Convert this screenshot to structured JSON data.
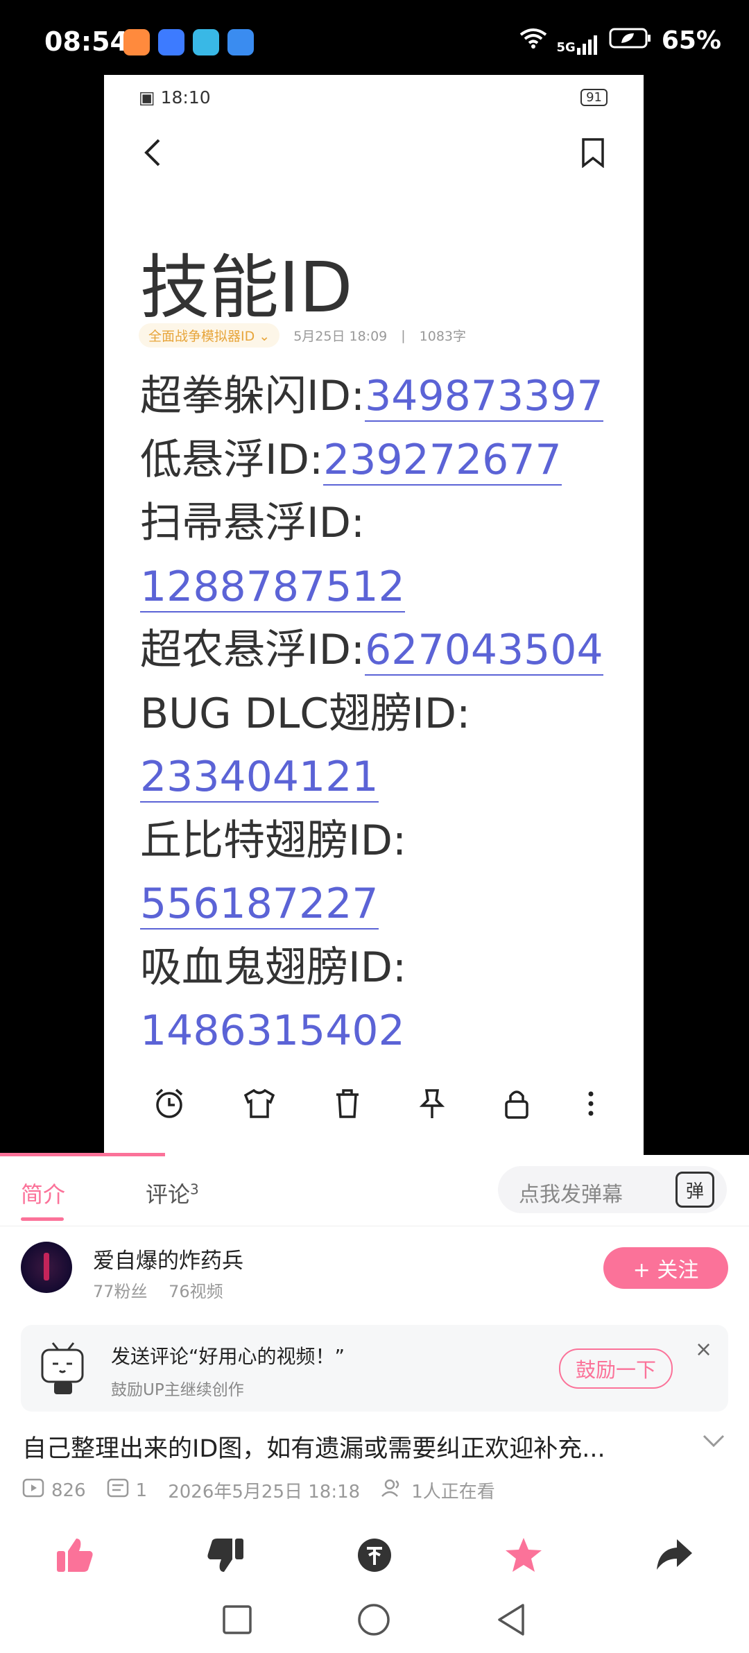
{
  "status_bar": {
    "time": "08:54",
    "battery": "65%",
    "network": "5G",
    "network_sub": "6"
  },
  "screenshot": {
    "status_time": "18:10",
    "battery": "91",
    "title": "技能ID",
    "tag": "全面战争模拟器ID",
    "date": "5月25日 18:09",
    "word_count": "1083字",
    "entries": [
      {
        "label": "超拳躲闪ID:",
        "id": "349873397",
        "wrap": false
      },
      {
        "label": "低悬浮ID:",
        "id": "239272677",
        "wrap": false
      },
      {
        "label": "扫帚悬浮ID:",
        "id": "1288787512",
        "wrap": true
      },
      {
        "label": "超农悬浮ID:",
        "id": "627043504",
        "wrap": false
      },
      {
        "label": "BUG DLC翅膀ID:",
        "id": "233404121",
        "wrap": true
      },
      {
        "label": "丘比特翅膀ID:",
        "id": "556187227",
        "wrap": true
      },
      {
        "label": "吸血鬼翅膀ID:",
        "id": "1486315402",
        "wrap": true
      }
    ],
    "toolbar_icons": [
      "alarm-icon",
      "shirt-icon",
      "trash-icon",
      "pin-icon",
      "lock-icon",
      "more-icon"
    ]
  },
  "tabs": {
    "intro": "简介",
    "comments": "评论",
    "comments_count": "3",
    "danmaku_placeholder": "点我发弹幕",
    "danmaku_icon_char": "弹"
  },
  "uploader": {
    "name": "爱自爆的炸药兵",
    "fans": "77粉丝",
    "videos": "76视频",
    "follow_label": "+ 关注"
  },
  "promo": {
    "title": "发送评论“好用心的视频！”",
    "subtitle": "鼓励UP主继续创作",
    "button": "鼓励一下",
    "close": "×"
  },
  "video": {
    "title": "自己整理出来的ID图，如有遗漏或需要纠正欢迎补充...",
    "views": "826",
    "danmaku_count": "1",
    "publish_date": "2026年5月25日 18:18",
    "watching": "1人正在看"
  },
  "colors": {
    "accent": "#fb7299",
    "link": "#5b63d6"
  }
}
